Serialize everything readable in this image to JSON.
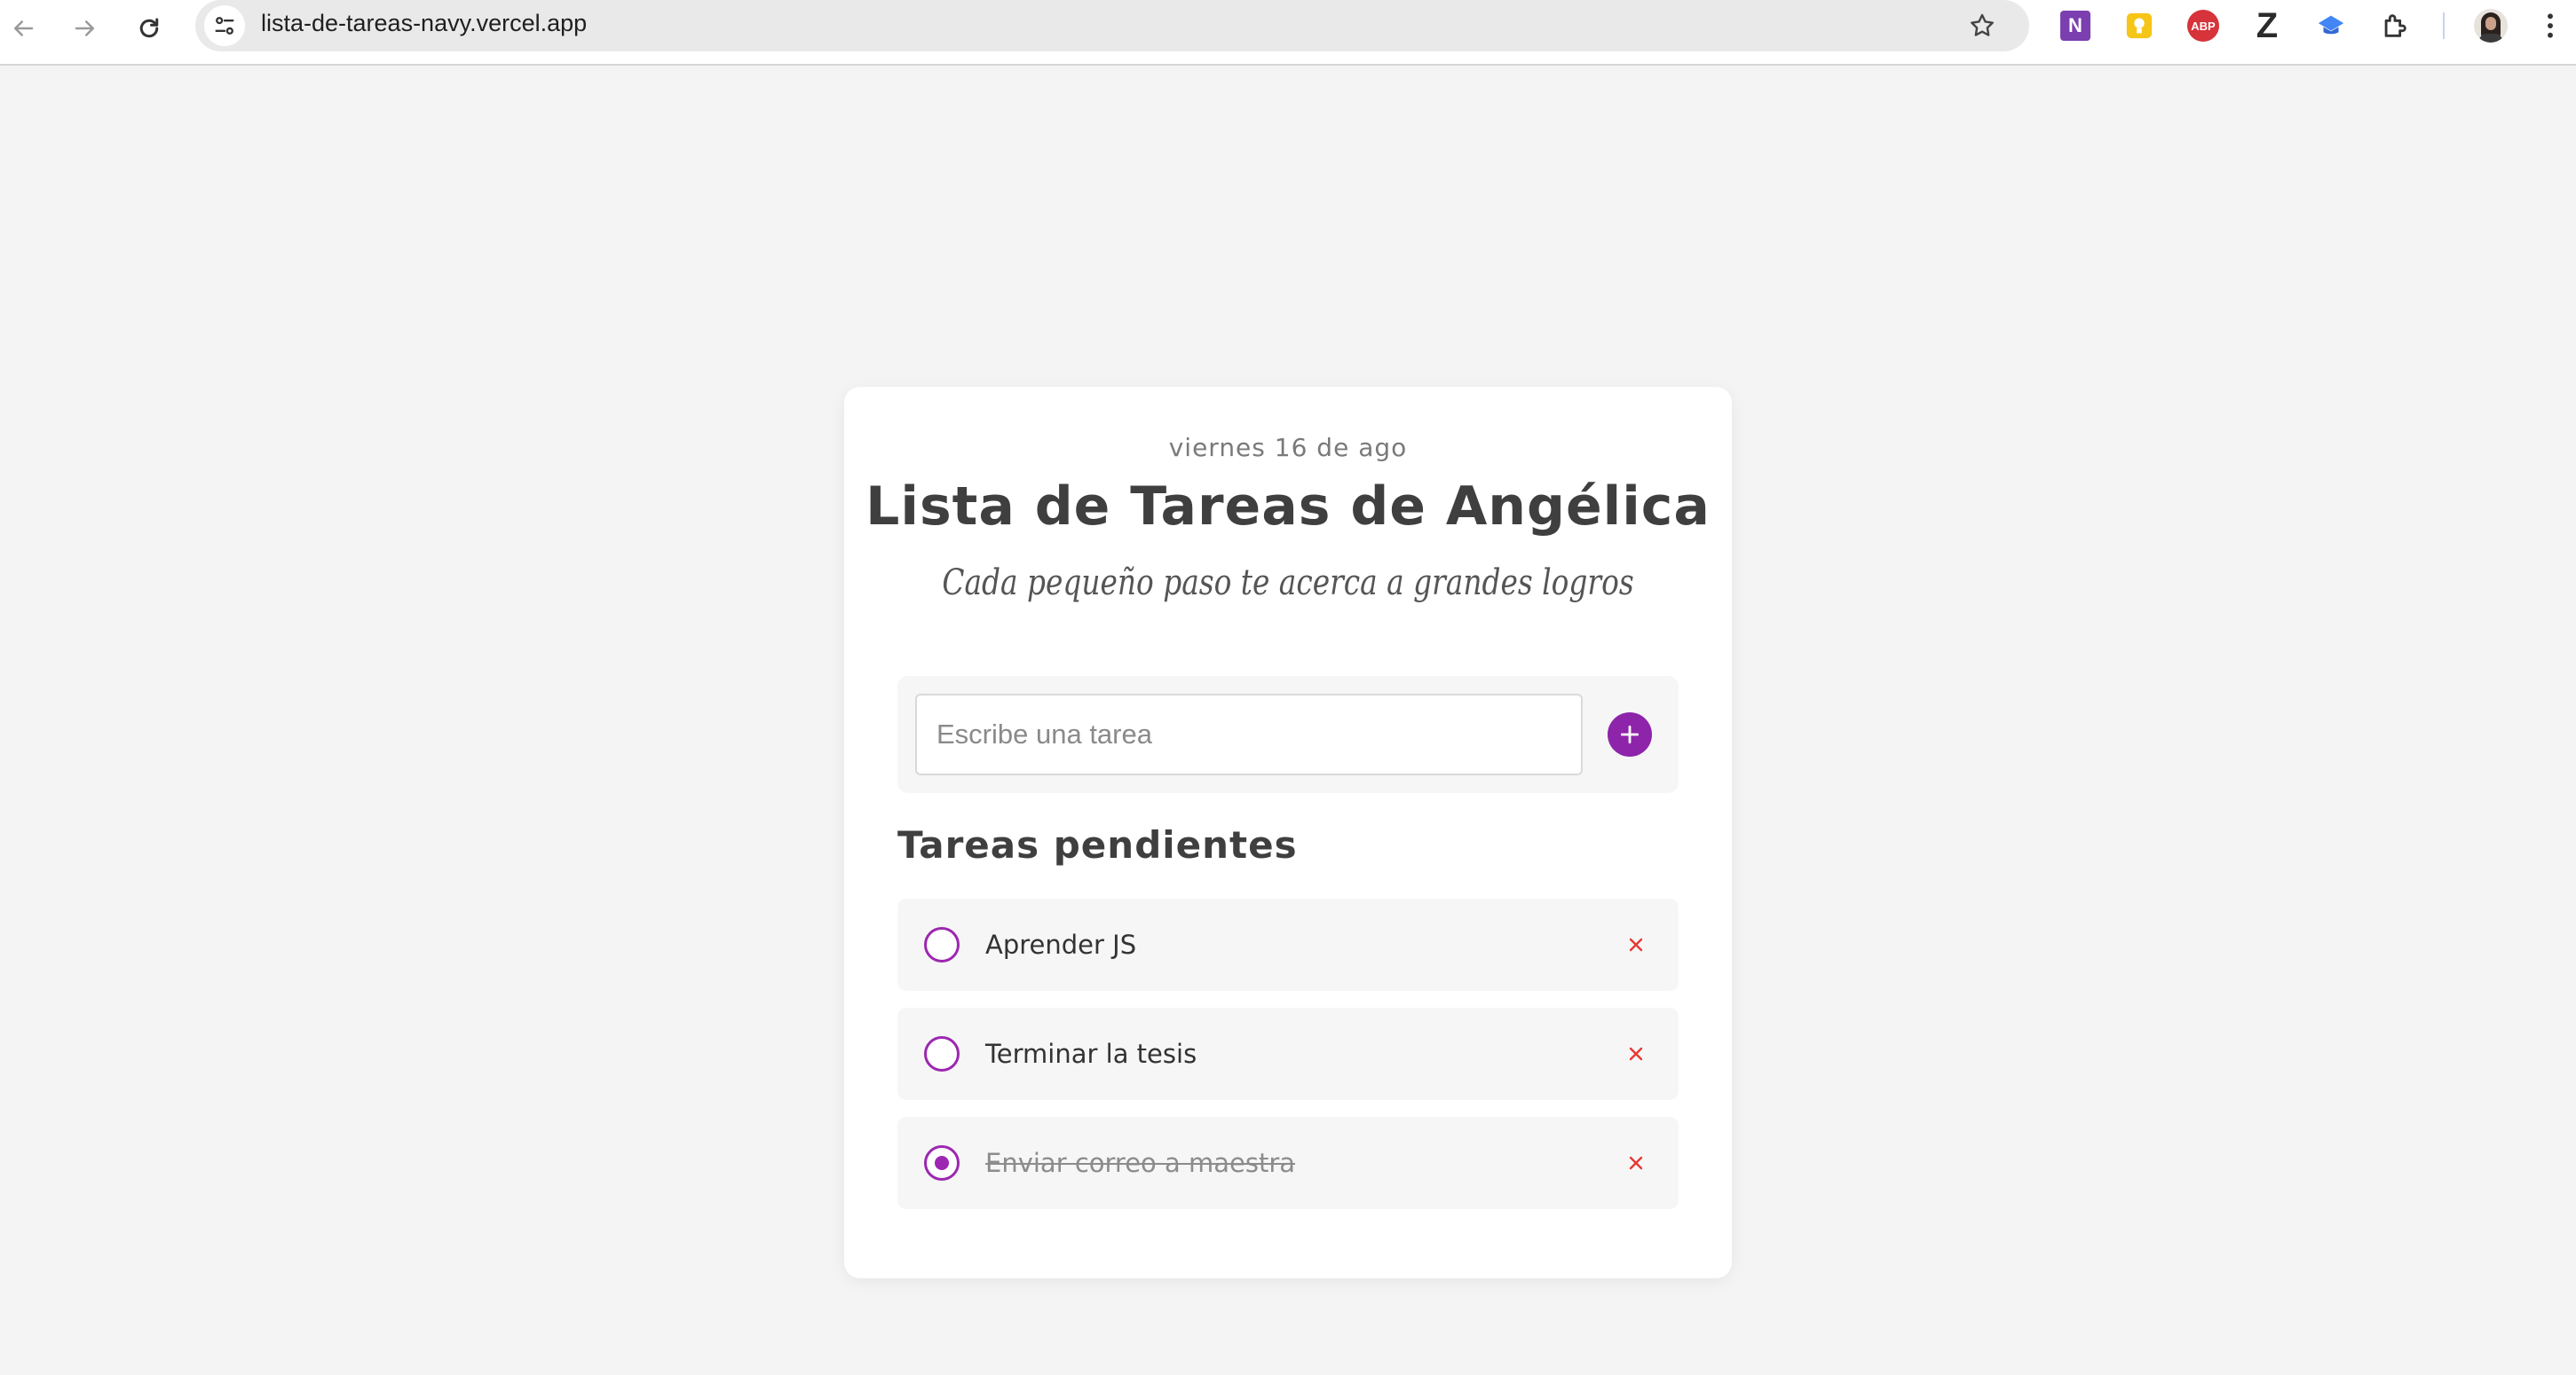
{
  "browser": {
    "url": "lista-de-tareas-navy.vercel.app",
    "extensions": [
      "onenote-icon",
      "keep-icon",
      "adblock-icon",
      "zotero-icon",
      "graduation-cap-icon",
      "extensions-puzzle-icon"
    ],
    "extension_labels": {
      "adblock": "ABP",
      "zotero": "Z",
      "onenote": "N"
    }
  },
  "card": {
    "date": "viernes 16 de ago",
    "title": "Lista de Tareas de Angélica",
    "subtitle": "Cada pequeño paso te acerca a grandes logros",
    "input": {
      "placeholder": "Escribe una tarea",
      "value": ""
    },
    "section_title": "Tareas pendientes",
    "tasks": [
      {
        "label": "Aprender JS",
        "completed": false
      },
      {
        "label": "Terminar la tesis",
        "completed": false
      },
      {
        "label": "Enviar correo a maestra",
        "completed": true
      }
    ]
  },
  "colors": {
    "accent": "#9c27b0",
    "delete": "#e53935",
    "background": "#f4f4f4",
    "card": "#ffffff"
  }
}
